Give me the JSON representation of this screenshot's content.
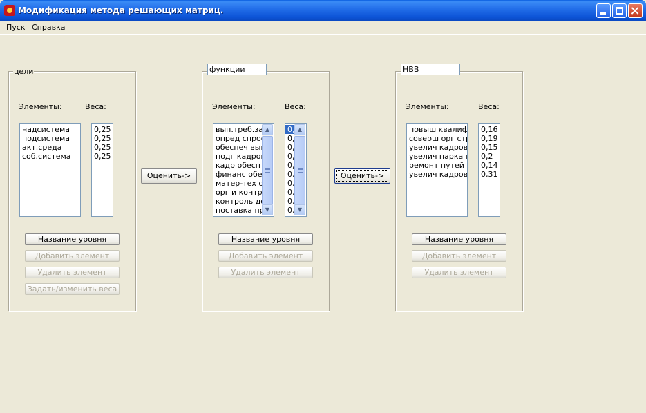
{
  "window": {
    "title": "Модификация метода решающих матриц."
  },
  "menu": [
    "Пуск",
    "Справка"
  ],
  "common": {
    "elements_label": "Элементы:",
    "weights_label": "Веса:",
    "level_name_button": "Название уровня",
    "add_element_button": "Добавить элемент",
    "delete_element_button": "Удалить элемент",
    "set_weights_button": "Задать/изменить веса",
    "evaluate_button": "Оценить->"
  },
  "panels": [
    {
      "name": "цели",
      "elements": [
        "надсистема",
        "подсистема",
        "акт.среда",
        "соб.система"
      ],
      "weights": [
        "0,25",
        "0,25",
        "0,25",
        "0,25"
      ]
    },
    {
      "name": "функции",
      "elements": [
        "вып.треб.зак",
        "опред спроса",
        "обеспеч вып",
        "подг кадров",
        "кадр обесп",
        "финанс обес",
        "матер-тех об",
        "орг и контро.",
        "контроль до",
        "поставка про"
      ],
      "weights": [
        "0,",
        "0,",
        "0,",
        "0,",
        "0,",
        "0,",
        "0,",
        "0,",
        "0,",
        "0,"
      ]
    },
    {
      "name": "НВВ",
      "elements": [
        "повыш квалиф к",
        "соверш орг стру",
        "увелич кадров п",
        "увелич парка по",
        "ремонт путей",
        "увелич кадров р"
      ],
      "weights": [
        "0,16",
        "0,19",
        "0,15",
        "0,2",
        "0,14",
        "0,31"
      ]
    }
  ]
}
